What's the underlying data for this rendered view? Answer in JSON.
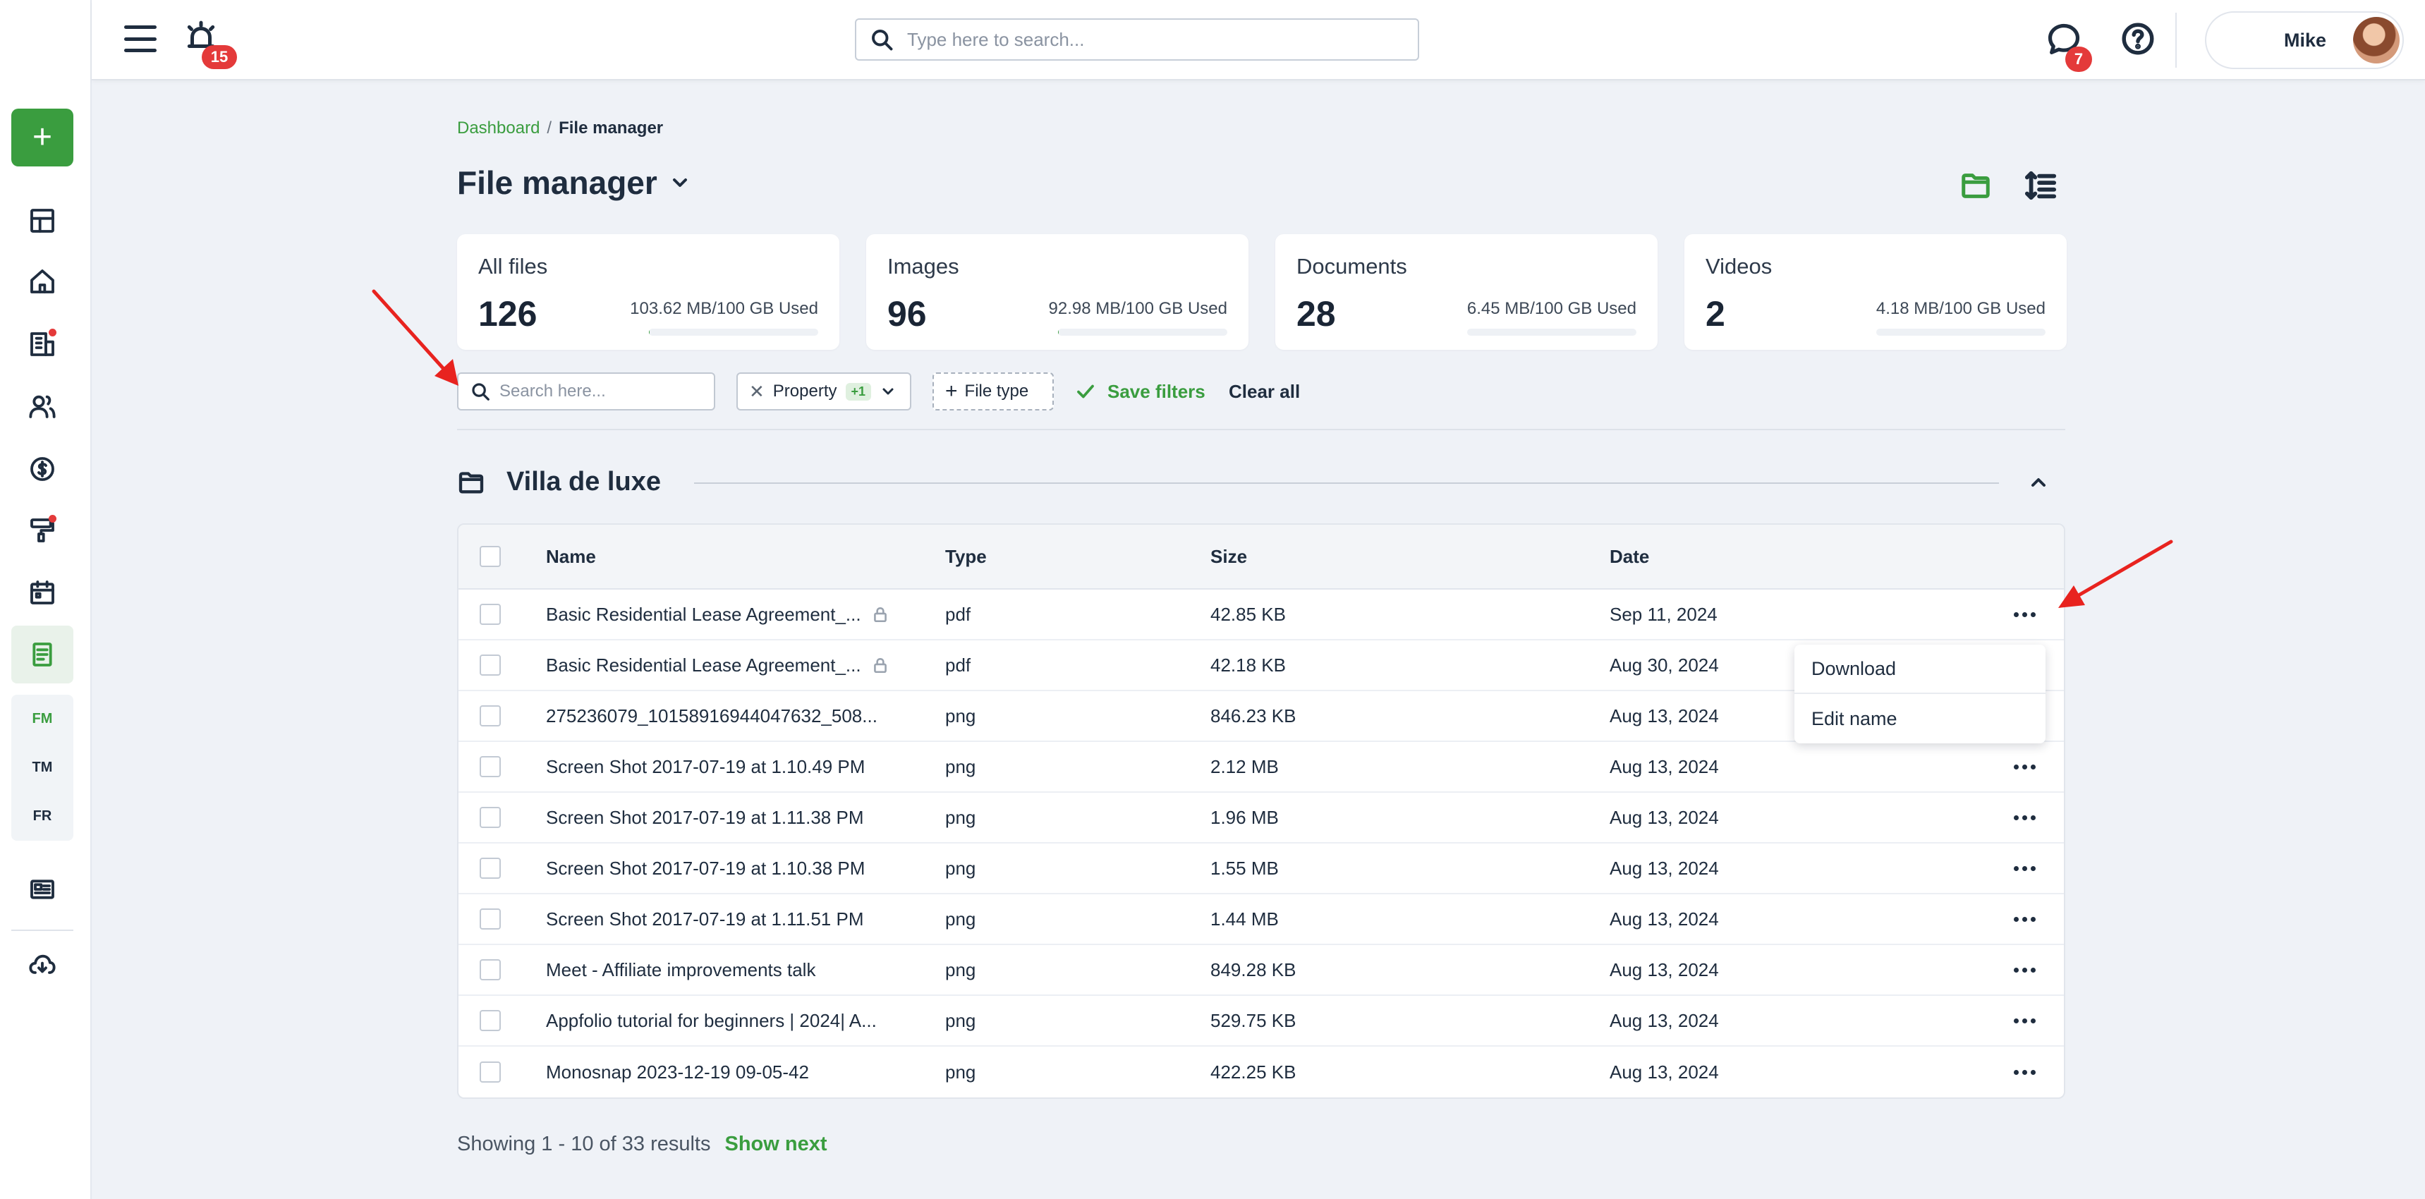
{
  "sidebar": {
    "add_label": "+",
    "sub_items": [
      "FM",
      "TM",
      "FR"
    ]
  },
  "topbar": {
    "notifications_count": "15",
    "search_placeholder": "Type here to search...",
    "messages_count": "7",
    "user_name": "Mike"
  },
  "breadcrumb": {
    "parent": "Dashboard",
    "separator": "/",
    "current": "File manager"
  },
  "page_title": "File manager",
  "stats": [
    {
      "label": "All files",
      "count": "126",
      "used": "103.62 MB/100 GB Used",
      "fraction": 0.001
    },
    {
      "label": "Images",
      "count": "96",
      "used": "92.98 MB/100 GB Used",
      "fraction": 0.001
    },
    {
      "label": "Documents",
      "count": "28",
      "used": "6.45 MB/100 GB Used",
      "fraction": 0.0001
    },
    {
      "label": "Videos",
      "count": "2",
      "used": "4.18 MB/100 GB Used",
      "fraction": 0.0001
    }
  ],
  "filters": {
    "search_placeholder": "Search here...",
    "property_label": "Property",
    "property_count": "+1",
    "file_type_label": "File type",
    "save_label": "Save filters",
    "clear_label": "Clear all"
  },
  "group": {
    "title": "Villa de luxe"
  },
  "table": {
    "headers": {
      "name": "Name",
      "type": "Type",
      "size": "Size",
      "date": "Date"
    },
    "rows": [
      {
        "name": "Basic Residential Lease Agreement_...",
        "type": "pdf",
        "size": "42.85 KB",
        "date": "Sep 11, 2024",
        "locked": true
      },
      {
        "name": "Basic Residential Lease Agreement_...",
        "type": "pdf",
        "size": "42.18 KB",
        "date": "Aug 30, 2024",
        "locked": true
      },
      {
        "name": "275236079_10158916944047632_508...",
        "type": "png",
        "size": "846.23 KB",
        "date": "Aug 13, 2024",
        "locked": false
      },
      {
        "name": "Screen Shot 2017-07-19 at 1.10.49 PM",
        "type": "png",
        "size": "2.12 MB",
        "date": "Aug 13, 2024",
        "locked": false
      },
      {
        "name": "Screen Shot 2017-07-19 at 1.11.38 PM",
        "type": "png",
        "size": "1.96 MB",
        "date": "Aug 13, 2024",
        "locked": false
      },
      {
        "name": "Screen Shot 2017-07-19 at 1.10.38 PM",
        "type": "png",
        "size": "1.55 MB",
        "date": "Aug 13, 2024",
        "locked": false
      },
      {
        "name": "Screen Shot 2017-07-19 at 1.11.51 PM",
        "type": "png",
        "size": "1.44 MB",
        "date": "Aug 13, 2024",
        "locked": false
      },
      {
        "name": "Meet - Affiliate improvements talk",
        "type": "png",
        "size": "849.28 KB",
        "date": "Aug 13, 2024",
        "locked": false
      },
      {
        "name": "Appfolio tutorial for beginners | 2024| A...",
        "type": "png",
        "size": "529.75 KB",
        "date": "Aug 13, 2024",
        "locked": false
      },
      {
        "name": "Monosnap 2023-12-19 09-05-42",
        "type": "png",
        "size": "422.25 KB",
        "date": "Aug 13, 2024",
        "locked": false
      }
    ]
  },
  "context_menu": {
    "items": [
      "Download",
      "Edit name"
    ]
  },
  "pagination": {
    "summary": "Showing 1 - 10 of 33 results",
    "next_label": "Show next"
  },
  "colors": {
    "accent": "#3a9d3f",
    "badge": "#e43a3a",
    "annotation_arrow": "#e8231f"
  },
  "icons": {
    "sidebar": [
      "add-icon",
      "dashboard-icon",
      "home-icon",
      "buildings-icon",
      "people-icon",
      "dollar-icon",
      "paint-roller-icon",
      "calendar-icon",
      "document-icon",
      "newspaper-icon",
      "cloud-download-icon"
    ],
    "topbar": [
      "hamburger-icon",
      "alarm-icon",
      "search-icon",
      "chat-icon",
      "help-icon"
    ]
  }
}
